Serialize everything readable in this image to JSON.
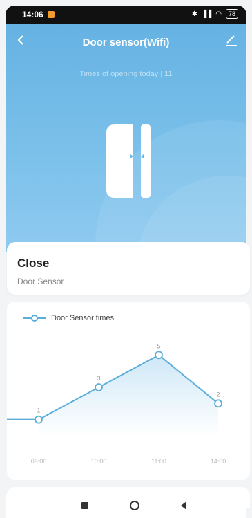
{
  "status_bar": {
    "time": "14:06",
    "battery": "78"
  },
  "header": {
    "title": "Door sensor(Wifi)",
    "times_opening": "Times of opening today | 11"
  },
  "status": {
    "title": "Close",
    "subtitle": "Door Sensor"
  },
  "colors": {
    "accent": "#5aaed9",
    "hero_top": "#65b2e3",
    "hero_bottom": "#8fcaf0"
  },
  "chart_data": {
    "type": "line",
    "series": [
      {
        "name": "Door Sensor times",
        "values": [
          1,
          3,
          5,
          2
        ]
      }
    ],
    "categories": [
      "09:00",
      "10:00",
      "11:00",
      "14:00"
    ],
    "point_labels": [
      "1",
      "3",
      "5",
      "2"
    ],
    "ylim": [
      0,
      6
    ],
    "grid": false,
    "legend": "top-left"
  }
}
